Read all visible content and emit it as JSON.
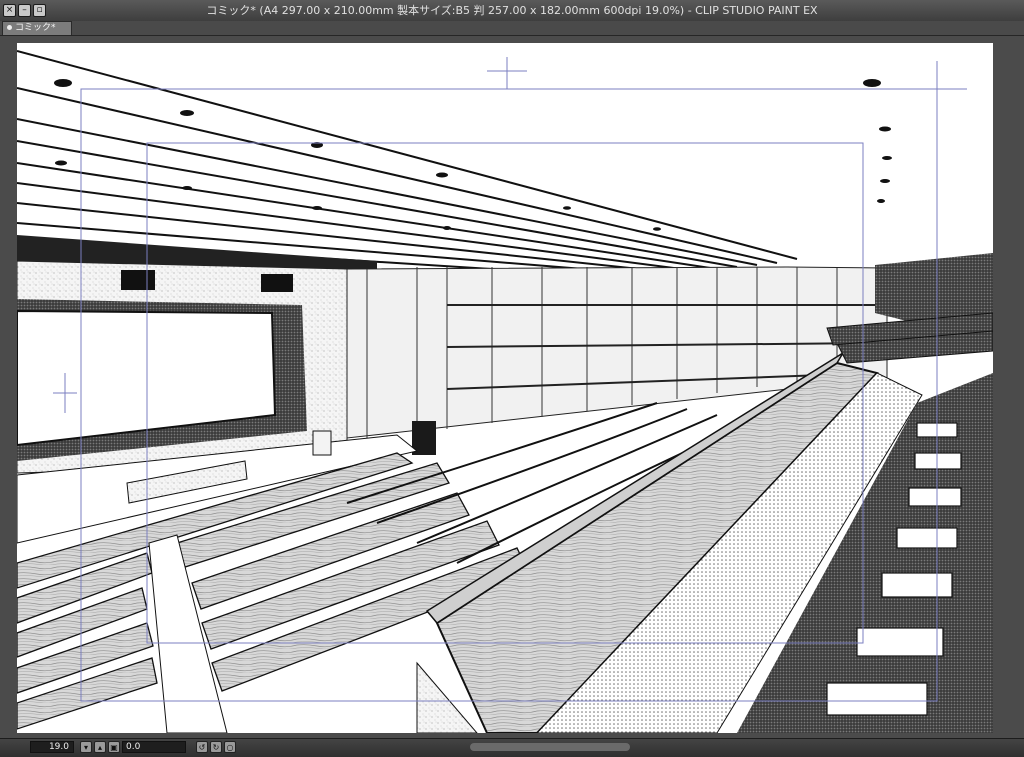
{
  "window": {
    "title": "コミック* (A4 297.00 x 210.00mm 製本サイズ:B5 判 257.00 x 182.00mm 600dpi 19.0%)  - CLIP STUDIO PAINT EX"
  },
  "tabs": [
    {
      "label": "コミック*"
    }
  ],
  "status": {
    "zoom": "19.0",
    "angle": "0.0"
  },
  "icons": {
    "close": "close-icon",
    "minimize": "minimize-icon",
    "maximize": "maximize-icon",
    "zoom_down": "chevron-down-icon",
    "zoom_up": "chevron-up-icon",
    "rotate_left": "rotate-left-icon",
    "rotate_right": "rotate-right-icon"
  },
  "colors": {
    "ui_dark": "#3a3a3a",
    "canvas": "#ffffff",
    "guide": "#7b7fc0"
  }
}
